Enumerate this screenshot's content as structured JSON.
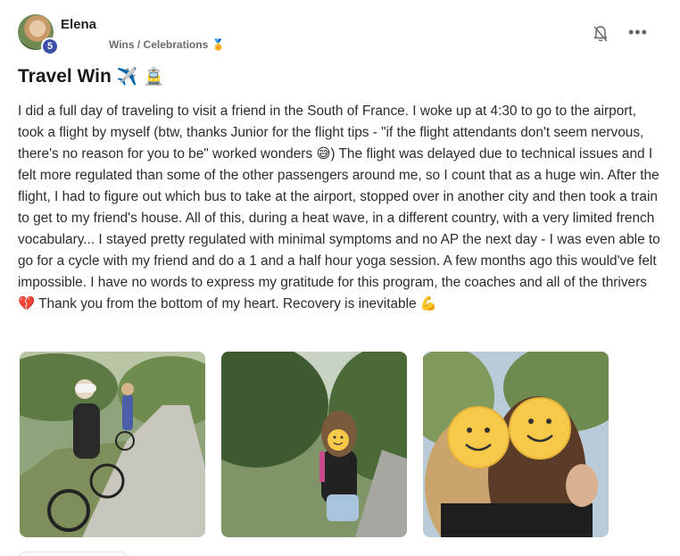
{
  "post": {
    "author": "Elena",
    "level": "5",
    "category": "Wins / Celebrations",
    "category_icon": "medal-icon",
    "title": "Travel Win",
    "title_emojis": [
      "✈️",
      "🚊"
    ],
    "body": "I did a full day of traveling to visit a friend in the South of France. I woke up at 4:30 to go to the airport, took a flight by myself (btw, thanks Junior for the flight tips - \"if the flight attendants don't seem nervous, there's no reason for you to be\" worked wonders 😅) The flight was delayed due to technical issues and I felt more regulated than some of the other passengers around me, so I count that as a huge win. After the flight, I had to figure out which bus to take at the airport, stopped over in another city and then took a train to get to my friend's house. All of this, during a heat wave, in a different country, with a very limited french vocabulary... I stayed pretty regulated with minimal symptoms and no AP the next day - I was even able to go for a cycle with my friend and do a 1 and a half hour yoga session. A few months ago this would've felt impossible. I have no words to express my gratitude for this program, the coaches and all of the thrivers 💔 Thank you from the bottom of my heart. Recovery is inevitable 💪"
  },
  "actions": {
    "notify_icon": "bell-off-icon",
    "more_icon": "more-dots-icon",
    "more_label": "•••"
  },
  "photos": [
    {
      "name": "photo-cycling-road"
    },
    {
      "name": "photo-cyclist-selfie"
    },
    {
      "name": "photo-friends-selfie"
    }
  ],
  "colors": {
    "badge": "#3b4fa8",
    "text": "#2c2c2c",
    "meta": "#6b6b6b"
  }
}
